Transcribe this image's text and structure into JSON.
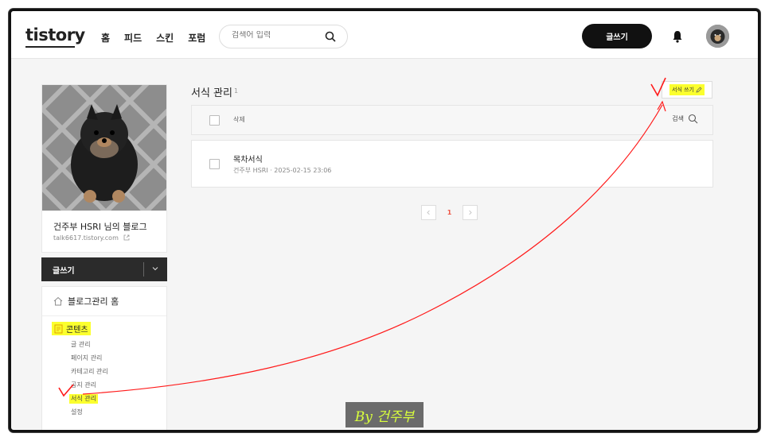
{
  "header": {
    "logo": "tistory",
    "nav": [
      "홈",
      "피드",
      "스킨",
      "포럼"
    ],
    "search_placeholder": "검색어 입력",
    "write_label": "글쓰기"
  },
  "sidebar": {
    "blog_name": "건주부 HSRI 님의 블로그",
    "blog_url": "talk6617.tistory.com",
    "write_label": "글쓰기",
    "home_label": "블로그관리 홈",
    "section_label": "콘텐츠",
    "submenu": [
      "글 관리",
      "페이지 관리",
      "카테고리 관리",
      "공지 관리",
      "서식 관리",
      "설정"
    ]
  },
  "main": {
    "title": "서식 관리",
    "count": "1",
    "new_button": "서식 쓰기",
    "delete_label": "삭제",
    "search_label": "검색",
    "items": [
      {
        "title": "목차서식",
        "author": "건주부 HSRI",
        "date": "2025-02-15 23:06"
      }
    ],
    "pagination": {
      "current": "1"
    }
  },
  "watermark": "By 건주부",
  "colors": {
    "highlight": "#fbff2e",
    "annotation": "#ff0000",
    "accent": "#e54"
  }
}
